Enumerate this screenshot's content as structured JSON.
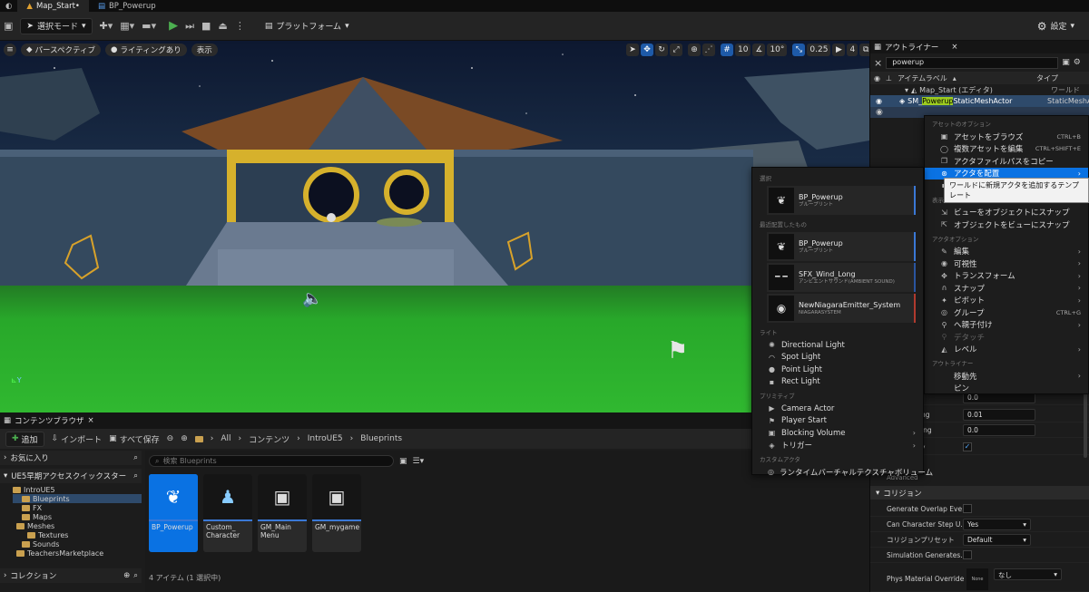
{
  "tabs": {
    "level": "Map_Start•",
    "blueprint": "BP_Powerup"
  },
  "toolbar": {
    "select_mode": "選択モード",
    "platform": "プラットフォーム",
    "settings": "設定"
  },
  "viewport": {
    "perspective": "パースペクティブ",
    "lighting": "ライティングあり",
    "show": "表示",
    "grid_snap": "10",
    "rot_snap": "10°",
    "scale_snap": "0.25",
    "cam_speed": "4"
  },
  "content_browser": {
    "tab": "コンテンツブラウザ",
    "add": "追加",
    "import": "インポート",
    "save_all": "すべて保存",
    "breadcrumb": [
      "All",
      "コンテンツ",
      "IntroUE5",
      "Blueprints"
    ],
    "search_placeholder": "検索 Blueprints",
    "favorites": "お気に入り",
    "quick_access": "UE5早期アクセスクイックスター",
    "collections": "コレクション",
    "tree": [
      "IntroUE5",
      "Blueprints",
      "FX",
      "Maps",
      "Meshes",
      "Textures",
      "Sounds",
      "TeachersMarketplace"
    ],
    "assets": [
      {
        "name": "BP_Powerup",
        "icon": "feather-icon"
      },
      {
        "name": "Custom_ Character",
        "icon": "character-icon"
      },
      {
        "name": "GM_Main Menu",
        "icon": "gamepad-icon"
      },
      {
        "name": "GM_mygame",
        "icon": "gamepad-icon"
      }
    ],
    "status": "4 アイテム (1 選択中)"
  },
  "outliner": {
    "tab": "アウトライナー",
    "search": "powerup",
    "col_label": "アイテムラベル",
    "col_type": "タイプ",
    "root": "Map_Start (エディタ)",
    "root_type": "ワールド",
    "item_prefix": "SM_",
    "item_highlight": "Powerup",
    "item_suffix": "StaticMeshActor",
    "item_type": "StaticMeshActo"
  },
  "details": {
    "vals": [
      "0.0",
      "0.01",
      "0.0"
    ],
    "labels": [
      "ng",
      "ing",
      "y"
    ],
    "advanced": "Advanced",
    "collision_header": "コリジョン",
    "rows": [
      {
        "label": "Generate Overlap Eve...",
        "value": ""
      },
      {
        "label": "Can Character Step U...",
        "value": "Yes"
      },
      {
        "label": "コリジョンプリセット",
        "value": "Default"
      },
      {
        "label": "Simulation Generates...",
        "value": ""
      },
      {
        "label": "Phys Material Override",
        "value": "None",
        "value2": "なし"
      }
    ]
  },
  "context_menu": {
    "asset_options": "アセットのオプション",
    "browse": "アセットをブラウズ",
    "browse_sc": "CTRL+B",
    "edit_multi": "複数アセットを編集",
    "edit_multi_sc": "CTRL+SHIFT+E",
    "copy_path": "アクタファイルパスをコピー",
    "place_actor": "アクタを配置",
    "tooltip": "ワールドに新規アクタを追加するテンプレート",
    "view_options": "表示オプション",
    "snap_view": "ビューをオブジェクトにスナップ",
    "snap_obj": "オブジェクトをビューにスナップ",
    "actor_options": "アクタオプション",
    "edit": "編集",
    "visibility": "可視性",
    "transform": "トランスフォーム",
    "snap": "スナップ",
    "pivot": "ピボット",
    "group": "グループ",
    "group_sc": "CTRL+G",
    "attach": "へ親子付け",
    "detach": "デタッチ",
    "level": "レベル",
    "outliner_sec": "アウトライナー",
    "move_to": "移動先",
    "pin": "ピン"
  },
  "place_menu": {
    "selected_sec": "選択",
    "recent_sec": "最近配置したもの",
    "selected": {
      "name": "BP_Powerup",
      "type": "ブループリント"
    },
    "recent": [
      {
        "name": "BP_Powerup",
        "type": "ブループリント",
        "icon": "feather-icon"
      },
      {
        "name": "SFX_Wind_Long",
        "type": "アンビエントサウンド(AMBIENT SOUND)",
        "icon": "sound-wave-icon"
      },
      {
        "name": "NewNiagaraEmitter_System",
        "type": "NIAGARASYSTEM",
        "icon": "sphere-icon"
      }
    ],
    "light_sec": "ライト",
    "lights": [
      "Directional Light",
      "Spot Light",
      "Point Light",
      "Rect Light"
    ],
    "prim_sec": "プリミティブ",
    "prims": [
      "Camera Actor",
      "Player Start",
      "Blocking Volume",
      "トリガー"
    ],
    "custom_sec": "カスタムアクタ",
    "custom": "ランタイムバーチャルテクスチャボリューム"
  }
}
